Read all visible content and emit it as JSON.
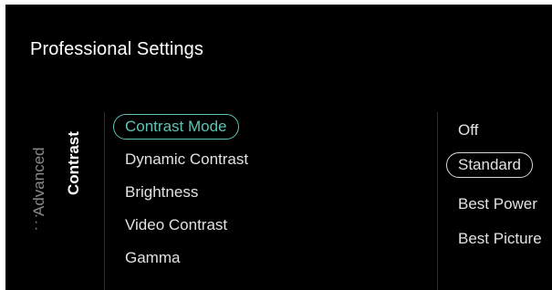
{
  "header": {
    "title": "Professional Settings"
  },
  "side_tabs": {
    "advanced": "Advanced",
    "contrast": "Contrast",
    "more": "⋮"
  },
  "menu": {
    "items": [
      {
        "label": "Contrast Mode",
        "selected": true
      },
      {
        "label": "Dynamic Contrast"
      },
      {
        "label": "Brightness"
      },
      {
        "label": "Video Contrast"
      },
      {
        "label": "Gamma"
      }
    ]
  },
  "options": {
    "items": [
      {
        "label": "Off"
      },
      {
        "label": "Standard",
        "current": true
      },
      {
        "label": "Best Power"
      },
      {
        "label": "Best Picture"
      }
    ]
  },
  "colors": {
    "background": "#000000",
    "accent": "#5ec4b4",
    "text": "#e2e2e2",
    "dim_text": "#8a8a8a"
  }
}
